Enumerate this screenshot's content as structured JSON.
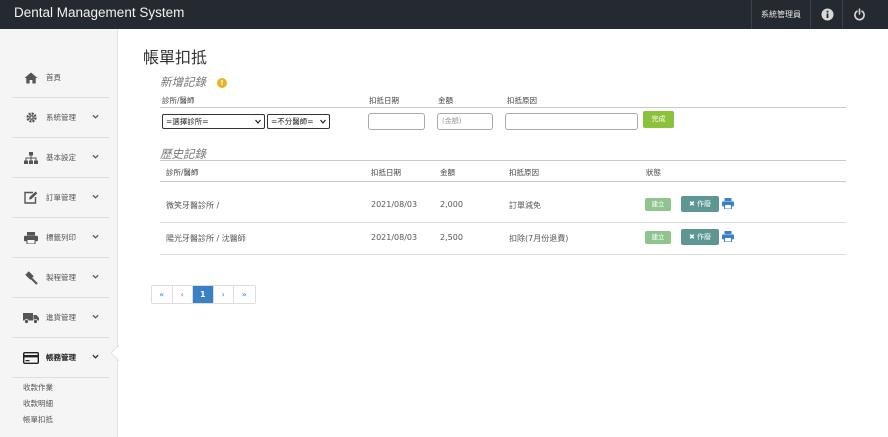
{
  "app": {
    "title": "Dental Management System",
    "user_label": "系統管理員"
  },
  "sidebar": {
    "items": [
      {
        "label": "首頁",
        "icon": "home-icon"
      },
      {
        "label": "系統管理",
        "icon": "gear-icon"
      },
      {
        "label": "基本設定",
        "icon": "sitemap-icon"
      },
      {
        "label": "訂單管理",
        "icon": "edit-icon"
      },
      {
        "label": "標籤列印",
        "icon": "printer-icon"
      },
      {
        "label": "製程管理",
        "icon": "gavel-icon"
      },
      {
        "label": "進貨管理",
        "icon": "truck-icon"
      },
      {
        "label": "帳務管理",
        "icon": "credit-card-icon"
      }
    ],
    "sub_items": [
      "收款作業",
      "收款明細",
      "帳單扣抵"
    ]
  },
  "page": {
    "title": "帳單扣抵"
  },
  "new_record": {
    "title": "新增記錄",
    "headers": {
      "clinic_doctor": "診所/醫師",
      "date": "扣抵日期",
      "amount": "金額",
      "reason": "扣抵原因"
    },
    "clinic_select": "=選擇診所=",
    "doctor_select": "=不分醫師=",
    "amount_placeholder": "(金額)",
    "submit_label": "完成"
  },
  "history": {
    "title": "歷史記錄",
    "headers": {
      "clinic_doctor": "診所/醫師",
      "date": "扣抵日期",
      "amount": "金額",
      "reason": "扣抵原因",
      "status": "狀態"
    },
    "rows": [
      {
        "clinic": "微笑牙醫診所 /",
        "date": "2021/08/03",
        "amount": "2,000",
        "reason": "訂單減免",
        "status": "建立",
        "void_label": "✖ 作廢"
      },
      {
        "clinic": "陽光牙醫診所 / 沈醫師",
        "date": "2021/08/03",
        "amount": "2,500",
        "reason": "扣除(7月份退費)",
        "status": "建立",
        "void_label": "✖ 作廢"
      }
    ]
  },
  "pagination": {
    "first": "«",
    "prev": "‹",
    "current": "1",
    "next": "›",
    "last": "»"
  },
  "colors": {
    "topbar": "#252a31",
    "accent_green": "#8cc13a",
    "badge_green": "#8fc48f",
    "void_teal": "#5e9693",
    "link_blue": "#3a80c4",
    "warning": "#e8b422"
  }
}
